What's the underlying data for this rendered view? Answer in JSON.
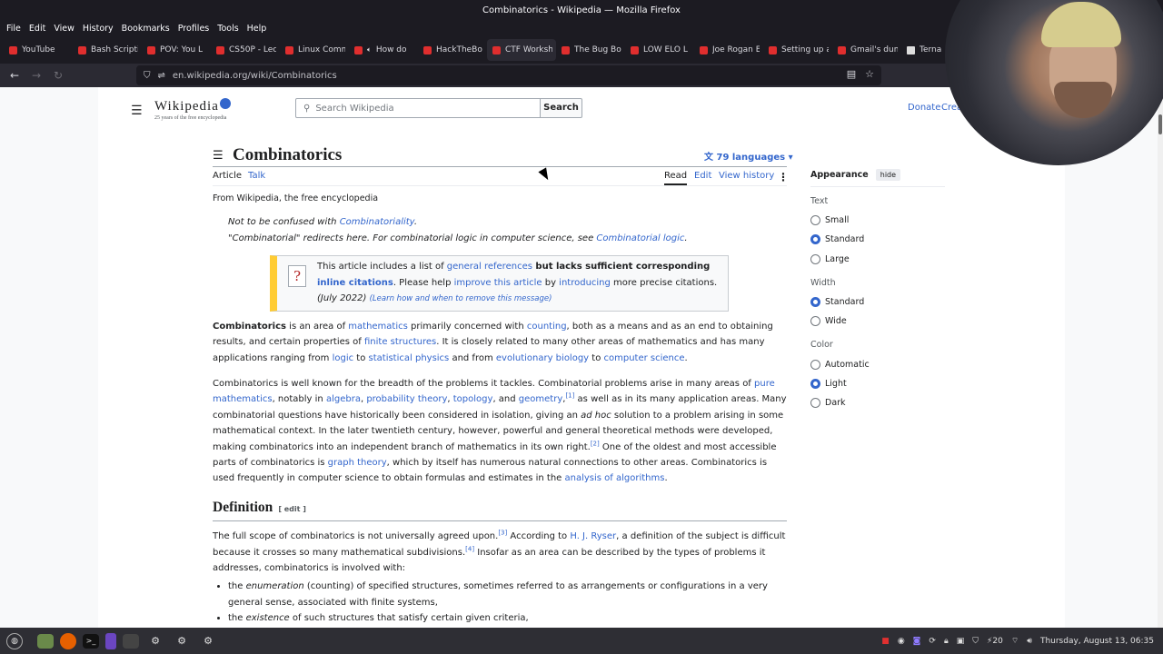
{
  "window": {
    "title": "Combinatorics - Wikipedia — Mozilla Firefox"
  },
  "menubar": [
    "File",
    "Edit",
    "View",
    "History",
    "Bookmarks",
    "Profiles",
    "Tools",
    "Help"
  ],
  "tabs": [
    {
      "label": "YouTube",
      "fav": "yt"
    },
    {
      "label": "Bash Scripti",
      "fav": "yt"
    },
    {
      "label": "POV: You L",
      "fav": "yt"
    },
    {
      "label": "CS50P - Lec",
      "fav": "yt"
    },
    {
      "label": "Linux Comm",
      "fav": "yt"
    },
    {
      "label": "How do",
      "fav": "yt",
      "audio": true
    },
    {
      "label": "HackTheBo",
      "fav": "yt"
    },
    {
      "label": "CTF Worksh",
      "fav": "yt",
      "active": true
    },
    {
      "label": "The Bug Bo",
      "fav": "yt"
    },
    {
      "label": "LOW ELO L",
      "fav": "yt"
    },
    {
      "label": "Joe Rogan E",
      "fav": "yt"
    },
    {
      "label": "Setting up a",
      "fav": "yt"
    },
    {
      "label": "Gmail's dum",
      "fav": "yt"
    },
    {
      "label": "Terna",
      "fav": "wt"
    }
  ],
  "nav": {
    "url": "en.wikipedia.org/wiki/Combinatorics",
    "back_icon": "←",
    "forward_icon": "→",
    "reload_icon": "↻"
  },
  "wiki": {
    "logo": "Wikipedia",
    "tagline": "25 years of the free encyclopedia",
    "search_placeholder": "Search Wikipedia",
    "search_button": "Search",
    "donate": "Donate",
    "create": "Create",
    "title": "Combinatorics",
    "languages": "79 languages",
    "tab_article": "Article",
    "tab_talk": "Talk",
    "tab_read": "Read",
    "tab_edit": "Edit",
    "tab_history": "View history",
    "from": "From Wikipedia, the free encyclopedia",
    "hatnote1_pre": "Not to be confused with ",
    "hatnote1_link": "Combinatoriality",
    "hatnote1_post": ".",
    "hatnote2_pre": "\"Combinatorial\" redirects here. For combinatorial logic in computer science, see ",
    "hatnote2_link": "Combinatorial logic",
    "hatnote2_post": ".",
    "ambox": {
      "t1": "This article includes a list of ",
      "l1": "general references",
      "b1": " but lacks sufficient corresponding ",
      "b2": "inline citations",
      "t2": ". Please help ",
      "l2": "improve this article",
      "t3": " by ",
      "l3": "introducing",
      "t4": " more precise citations.",
      "date": "(July 2022)",
      "learn": "(Learn how and when to remove this message)"
    },
    "definition_heading": "Definition",
    "edit_label": "[ edit ]"
  },
  "appearance": {
    "title": "Appearance",
    "hide": "hide",
    "groups": [
      {
        "name": "Text",
        "options": [
          {
            "label": "Small",
            "on": false
          },
          {
            "label": "Standard",
            "on": true
          },
          {
            "label": "Large",
            "on": false
          }
        ]
      },
      {
        "name": "Width",
        "options": [
          {
            "label": "Standard",
            "on": true
          },
          {
            "label": "Wide",
            "on": false
          }
        ]
      },
      {
        "name": "Color",
        "options": [
          {
            "label": "Automatic",
            "on": false
          },
          {
            "label": "Light",
            "on": true
          },
          {
            "label": "Dark",
            "on": false
          }
        ]
      }
    ]
  },
  "taskbar": {
    "clock": "Thursday, August 13, 06:35",
    "volume": "20"
  },
  "colors": {
    "link": "#3366cc",
    "ambox_accent": "#ffcc33"
  }
}
